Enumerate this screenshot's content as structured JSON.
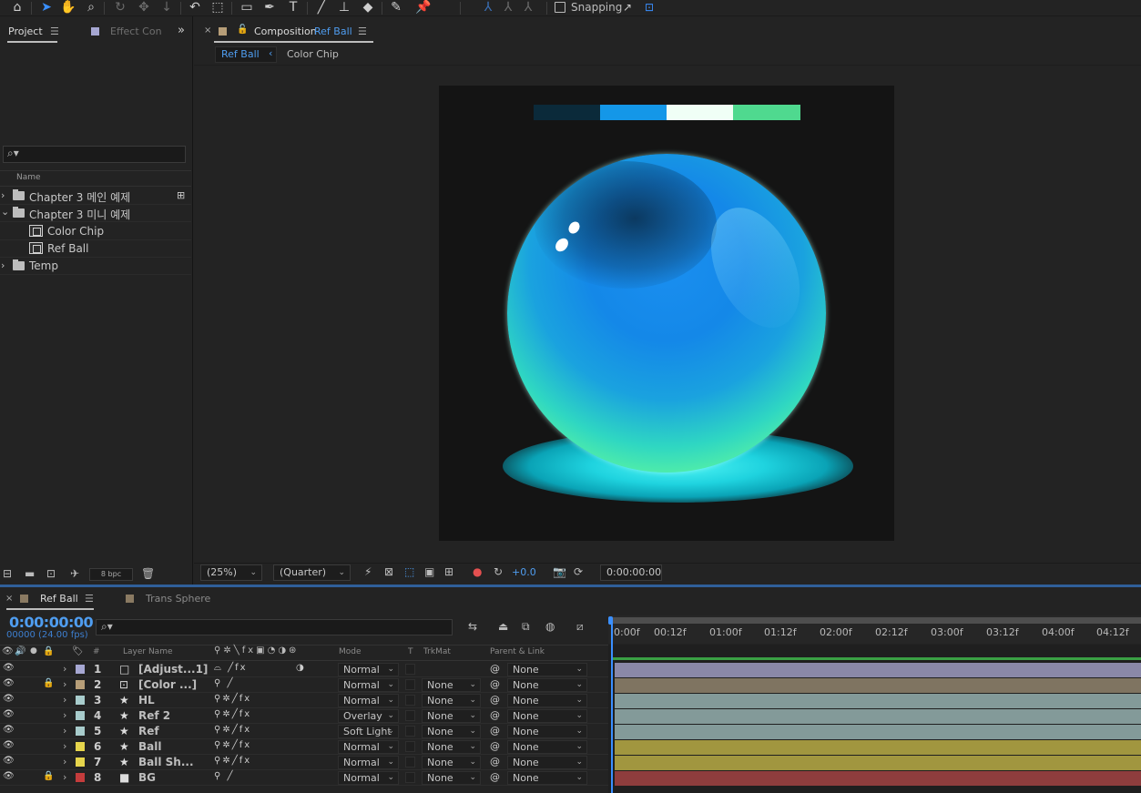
{
  "toolbar": {
    "snapping_label": "Snapping",
    "tools": [
      "home-icon",
      "selection-tool-icon",
      "hand-tool-icon",
      "zoom-tool-icon",
      "orbit-camera-icon",
      "pan-camera-icon",
      "dolly-camera-icon",
      "rotation-tool-icon",
      "pan-behind-tool-icon",
      "rectangle-tool-icon",
      "pen-tool-icon",
      "type-tool-icon",
      "brush-tool-icon",
      "clone-stamp-icon",
      "eraser-tool-icon",
      "roto-brush-icon",
      "puppet-pin-icon"
    ]
  },
  "project_panel": {
    "tab_project": "Project",
    "tab_effects": "Effect Con",
    "name_header": "Name",
    "items": [
      {
        "label": "Chapter 3 메인 예제",
        "type": "folder",
        "expanded": false
      },
      {
        "label": "Chapter 3 미니 예제",
        "type": "folder",
        "expanded": true
      },
      {
        "label": "Color Chip",
        "type": "composition"
      },
      {
        "label": "Ref Ball",
        "type": "composition"
      },
      {
        "label": "Temp",
        "type": "folder",
        "expanded": false
      }
    ],
    "bpc_label": "8 bpc"
  },
  "composition_panel": {
    "tab_prefix": "Composition",
    "tab_name": "Ref Ball",
    "breadcrumb": [
      "Ref Ball",
      "Color Chip"
    ],
    "color_chips": [
      "#0b2a3a",
      "#1497e8",
      "#f0fff6",
      "#4fd98f"
    ],
    "zoom": "(25%)",
    "resolution": "(Quarter)",
    "exposure": "+0.0",
    "timecode": "0:00:00:00"
  },
  "timeline": {
    "tabs": [
      "Ref Ball",
      "Trans Sphere"
    ],
    "tab_colors": [
      "#8a7a62",
      "#8a7a62"
    ],
    "timecode": "0:00:00:00",
    "frame_info": "00000 (24.00 fps)",
    "ruler": [
      "0:00f",
      "00:12f",
      "01:00f",
      "01:12f",
      "02:00f",
      "02:12f",
      "03:00f",
      "03:12f",
      "04:00f",
      "04:12f"
    ],
    "columns": {
      "number": "#",
      "layer_name": "Layer Name",
      "mode": "Mode",
      "t": "T",
      "trkmat": "TrkMat",
      "parent": "Parent & Link"
    },
    "layers": [
      {
        "num": "1",
        "name": "[Adjust...1]",
        "label_color": "#a6a7d2",
        "mode": "Normal",
        "trkmat": "",
        "parent": "None",
        "bar_color": "#8a88a8",
        "locked": false
      },
      {
        "num": "2",
        "name": "[Color ...]",
        "label_color": "#b79e78",
        "mode": "Normal",
        "trkmat": "None",
        "parent": "None",
        "bar_color": "#7f7461",
        "locked": true
      },
      {
        "num": "3",
        "name": "HL",
        "label_color": "#a8cccc",
        "mode": "Normal",
        "trkmat": "None",
        "parent": "None",
        "bar_color": "#839a99",
        "locked": false
      },
      {
        "num": "4",
        "name": "Ref 2",
        "label_color": "#a8cccc",
        "mode": "Overlay",
        "trkmat": "None",
        "parent": "None",
        "bar_color": "#839a99",
        "locked": false
      },
      {
        "num": "5",
        "name": "Ref",
        "label_color": "#a8cccc",
        "mode": "Soft Light",
        "trkmat": "None",
        "parent": "None",
        "bar_color": "#839a99",
        "locked": false
      },
      {
        "num": "6",
        "name": "Ball",
        "label_color": "#e6d54c",
        "mode": "Normal",
        "trkmat": "None",
        "parent": "None",
        "bar_color": "#a1963f",
        "locked": false
      },
      {
        "num": "7",
        "name": "Ball Sh...",
        "label_color": "#e6d54c",
        "mode": "Normal",
        "trkmat": "None",
        "parent": "None",
        "bar_color": "#a1963f",
        "locked": false
      },
      {
        "num": "8",
        "name": "BG",
        "label_color": "#c43c3c",
        "mode": "Normal",
        "trkmat": "None",
        "parent": "None",
        "bar_color": "#8e3d3d",
        "locked": true
      }
    ]
  }
}
